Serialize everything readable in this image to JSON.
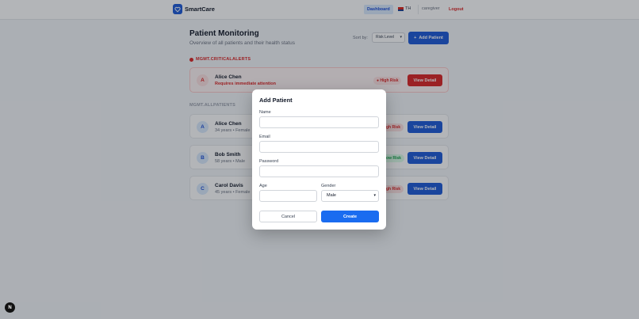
{
  "header": {
    "brand": "SmartCare",
    "nav_dashboard": "Dashboard",
    "lang": "TH",
    "user_role": "caregiver",
    "logout": "Logout"
  },
  "main": {
    "title": "Patient Monitoring",
    "subtitle": "Overview of all patients and their health status",
    "sort_label": "Sort by:",
    "sort_value": "Risk Level",
    "add_patient": "Add Patient",
    "critical_section": "MGMT.CRITICALALERTS",
    "all_section": "MGMT.ALLPATIENTS",
    "critical_patient": {
      "initial": "A",
      "name": "Alice Chen",
      "meta": "Requires immediate attention",
      "badge": "High Risk",
      "action": "View Detail"
    },
    "patients": [
      {
        "initial": "A",
        "name": "Alice Chen",
        "meta": "34 years • Female",
        "badge": "High Risk",
        "action": "View Detail"
      },
      {
        "initial": "B",
        "name": "Bob Smith",
        "meta": "58 years • Male",
        "badge": "Low Risk",
        "action": "View Detail"
      },
      {
        "initial": "C",
        "name": "Carol Davis",
        "meta": "45 years • Female",
        "badge": "High Risk",
        "action": "View Detail"
      }
    ]
  },
  "modal": {
    "title": "Add Patient",
    "name_label": "Name",
    "name_value": "",
    "email_label": "Email",
    "email_value": "",
    "password_label": "Password",
    "password_value": "",
    "age_label": "Age",
    "age_value": "",
    "gender_label": "Gender",
    "gender_value": "Male",
    "cancel": "Cancel",
    "create": "Create"
  },
  "dev_badge": "N",
  "colors": {
    "primary": "#1e5bd8",
    "danger": "#dc2626",
    "success": "#16a34a"
  }
}
